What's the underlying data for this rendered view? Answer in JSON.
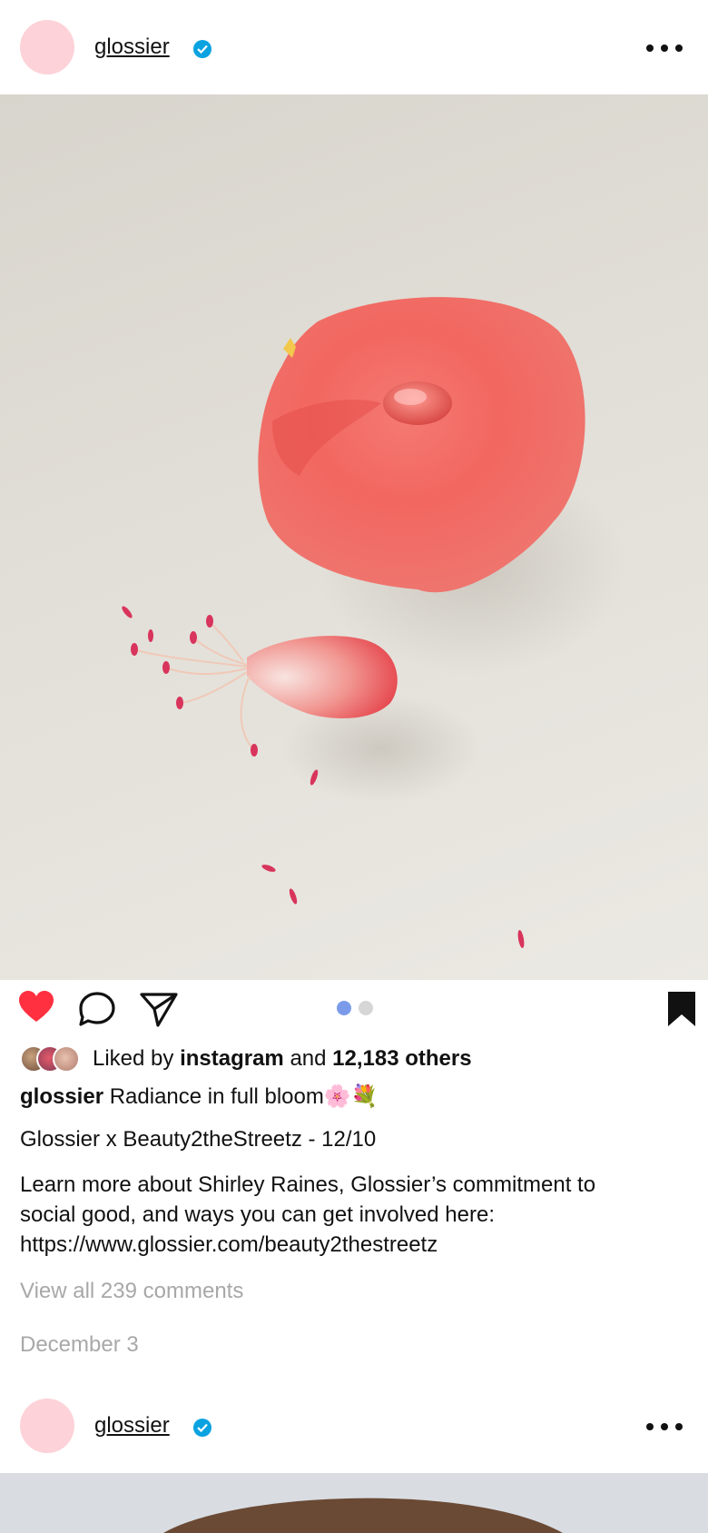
{
  "post": {
    "username": "glossier",
    "verified": true,
    "like_icon": "heart-filled-icon",
    "comment_icon": "comment-bubble-icon",
    "share_icon": "paper-plane-icon",
    "save_icon": "bookmark-filled-icon",
    "carousel": {
      "total": 2,
      "active": 1,
      "active_color": "#7b9bea",
      "inactive_color": "#d6d6d6"
    },
    "likes": {
      "prefix": "Liked by",
      "liker": "instagram",
      "conjunction": "and",
      "others": "12,183 others"
    },
    "caption": {
      "username": "glossier",
      "text": "Radiance in full bloom🌸💐"
    },
    "caption_line2": "Glossier x Beauty2theStreetz - 12/10",
    "caption_paragraph": [
      "Learn more about Shirley Raines, Glossier’s commitment to",
      "social good, and ways you can get involved here:",
      "https://www.glossier.com/beauty2thestreetz"
    ],
    "view_comments": "View all 239 comments",
    "date": "December 3"
  },
  "next_post": {
    "username": "glossier",
    "verified": true
  },
  "colors": {
    "heart": "#ff3040",
    "verified": "#0aa2e0",
    "avatar": "#fdd2d8",
    "muted_text": "#a8a8a8"
  }
}
